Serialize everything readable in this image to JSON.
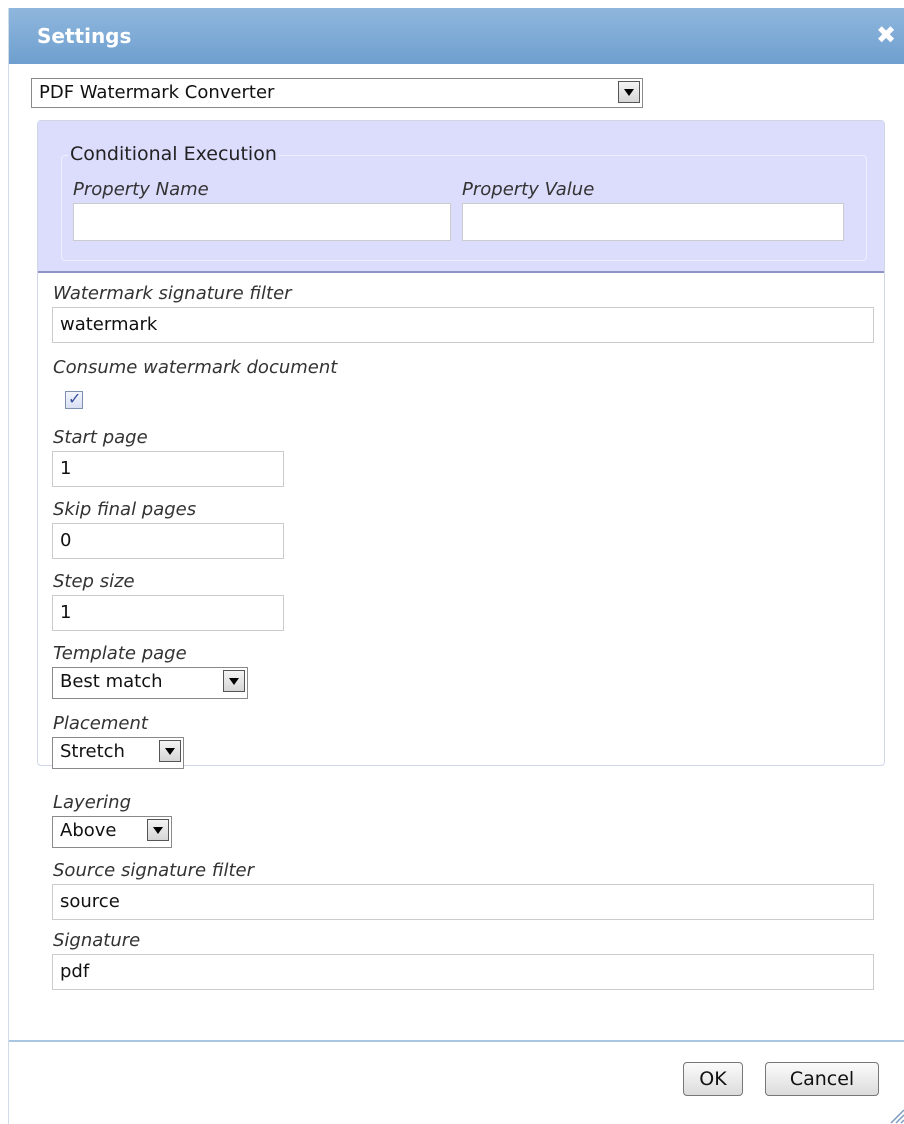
{
  "dialog": {
    "title": "Settings",
    "close_icon": "close-icon"
  },
  "converter_select": {
    "value": "PDF Watermark Converter"
  },
  "conditional_execution": {
    "legend": "Conditional Execution",
    "property_name_label": "Property Name",
    "property_name_value": "",
    "property_value_label": "Property Value",
    "property_value_value": ""
  },
  "fields": {
    "watermark_signature_filter": {
      "label": "Watermark signature filter",
      "value": "watermark"
    },
    "consume_watermark_document": {
      "label": "Consume watermark document",
      "checked": true
    },
    "start_page": {
      "label": "Start page",
      "value": "1"
    },
    "skip_final_pages": {
      "label": "Skip final pages",
      "value": "0"
    },
    "step_size": {
      "label": "Step size",
      "value": "1"
    },
    "template_page": {
      "label": "Template page",
      "value": "Best match"
    },
    "placement": {
      "label": "Placement",
      "value": "Stretch"
    },
    "layering": {
      "label": "Layering",
      "value": "Above"
    },
    "source_signature_filter": {
      "label": "Source signature filter",
      "value": "source"
    },
    "signature": {
      "label": "Signature",
      "value": "pdf"
    }
  },
  "buttons": {
    "ok": "OK",
    "cancel": "Cancel"
  },
  "colors": {
    "titlebar": "#7fabd6",
    "conditional_bg": "#dcdcfd"
  }
}
